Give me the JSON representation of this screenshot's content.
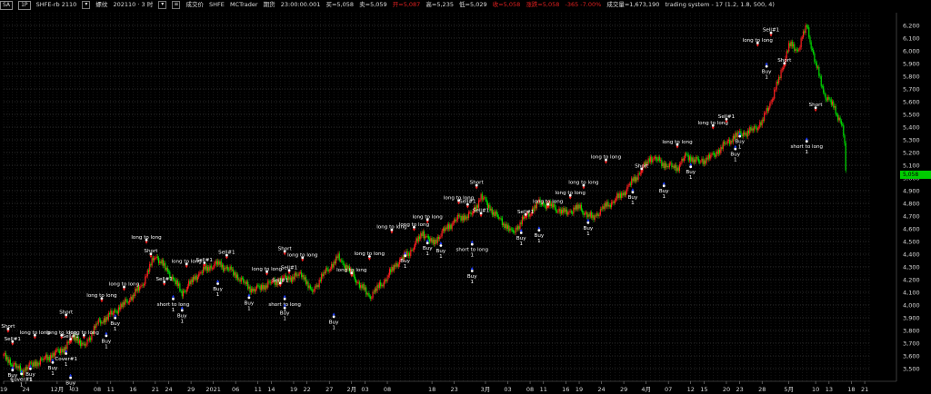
{
  "header": {
    "tab_symbol": "SA",
    "tab_interval": "1P",
    "symbol_name": "SHFE-rb 2110",
    "contract": "螺纹",
    "bar_period": "202110 · 3 时",
    "status_items": [
      "成交价",
      "SHFE",
      "MCTrader",
      "期货"
    ],
    "time": "23:00:00.001",
    "buy_label": "买=5,058",
    "sell_label": "卖=5,059",
    "open_label": "开=5,087",
    "high_label": "高=5,235",
    "low_label": "低=5,029",
    "close_label": "收=5,058",
    "change_label": "涨跌=5,058",
    "change_pct_label": "-365  -7.00%",
    "volume_label": "成交量=1,673,190",
    "system_label": "trading system - 17 (1.2,  1.8,  500,  4)"
  },
  "last_price_label": "5,058",
  "colors": {
    "up": "#ff2020",
    "down": "#00dd00",
    "grid": "#555555",
    "buy": "#2040ff",
    "sell": "#ff2020",
    "bg": "#000000",
    "last": "#00cc00"
  },
  "chart_data": {
    "type": "candlestick",
    "y_range": [
      3400,
      6300
    ],
    "y_ticks": [
      3500,
      3600,
      3700,
      3800,
      3900,
      4000,
      4100,
      4200,
      4300,
      4400,
      4500,
      4600,
      4700,
      4800,
      4900,
      5000,
      5100,
      5200,
      5300,
      5400,
      5500,
      5600,
      5700,
      5800,
      5900,
      6000,
      6100,
      6200
    ],
    "y_tick_labels": [
      "3,500",
      "3,600",
      "3,700",
      "3,800",
      "3,900",
      "4,000",
      "4,100",
      "4,200",
      "4,300",
      "4,400",
      "4,500",
      "4,600",
      "4,700",
      "4,800",
      "4,900",
      "5,000",
      "5,100",
      "5,200",
      "5,300",
      "5,400",
      "5,500",
      "5,600",
      "5,700",
      "5,800",
      "5,900",
      "6,000",
      "6,100",
      "6,200"
    ],
    "x_ticks": [
      "19",
      "24",
      "12月",
      "03",
      "08",
      "11",
      "16",
      "21",
      "24",
      "29",
      "2021",
      "06",
      "11",
      "14",
      "19",
      "22",
      "27",
      "2月",
      "03",
      "08",
      "18",
      "23",
      "3月",
      "03",
      "08",
      "11",
      "16",
      "19",
      "24",
      "29",
      "4月",
      "07",
      "12",
      "15",
      "20",
      "23",
      "28",
      "5月",
      "10",
      "13",
      "18",
      "21"
    ],
    "x_tick_days": [
      0,
      5,
      12,
      16,
      21,
      24,
      29,
      34,
      37,
      42,
      47,
      52,
      57,
      60,
      65,
      68,
      73,
      78,
      81,
      86,
      96,
      101,
      108,
      113,
      118,
      121,
      126,
      129,
      134,
      139,
      144,
      149,
      154,
      157,
      162,
      165,
      170,
      176,
      182,
      185,
      190,
      193
    ],
    "last_day": 189,
    "last_close": 5058,
    "anchors": [
      [
        0,
        3600
      ],
      [
        4,
        3480
      ],
      [
        8,
        3560
      ],
      [
        13,
        3640
      ],
      [
        16,
        3760
      ],
      [
        18,
        3660
      ],
      [
        21,
        3860
      ],
      [
        24,
        3920
      ],
      [
        27,
        4010
      ],
      [
        31,
        4150
      ],
      [
        34,
        4400
      ],
      [
        36,
        4300
      ],
      [
        38,
        4200
      ],
      [
        40,
        4100
      ],
      [
        43,
        4220
      ],
      [
        46,
        4300
      ],
      [
        48,
        4330
      ],
      [
        52,
        4240
      ],
      [
        56,
        4110
      ],
      [
        60,
        4180
      ],
      [
        64,
        4210
      ],
      [
        67,
        4250
      ],
      [
        69,
        4090
      ],
      [
        72,
        4260
      ],
      [
        75,
        4370
      ],
      [
        78,
        4250
      ],
      [
        82,
        4060
      ],
      [
        85,
        4180
      ],
      [
        88,
        4320
      ],
      [
        91,
        4420
      ],
      [
        94,
        4570
      ],
      [
        96,
        4480
      ],
      [
        99,
        4600
      ],
      [
        102,
        4680
      ],
      [
        105,
        4720
      ],
      [
        107,
        4850
      ],
      [
        110,
        4720
      ],
      [
        112,
        4650
      ],
      [
        114,
        4560
      ],
      [
        117,
        4700
      ],
      [
        120,
        4800
      ],
      [
        123,
        4780
      ],
      [
        126,
        4720
      ],
      [
        129,
        4770
      ],
      [
        132,
        4680
      ],
      [
        135,
        4780
      ],
      [
        139,
        4880
      ],
      [
        142,
        5020
      ],
      [
        145,
        5160
      ],
      [
        148,
        5110
      ],
      [
        151,
        5080
      ],
      [
        153,
        5170
      ],
      [
        156,
        5130
      ],
      [
        159,
        5170
      ],
      [
        162,
        5280
      ],
      [
        164,
        5330
      ],
      [
        167,
        5360
      ],
      [
        170,
        5440
      ],
      [
        172,
        5600
      ],
      [
        174,
        5800
      ],
      [
        176,
        6050
      ],
      [
        178,
        6000
      ],
      [
        180,
        6200
      ],
      [
        182,
        5900
      ],
      [
        184,
        5650
      ],
      [
        186,
        5560
      ],
      [
        188,
        5420
      ],
      [
        189,
        5058
      ]
    ],
    "signals": [
      {
        "day": 1,
        "price": 3780,
        "text": "Short",
        "kind": "sell"
      },
      {
        "day": 2,
        "price": 3680,
        "text": "Sell#1",
        "kind": "sell"
      },
      {
        "day": 2,
        "price": 3520,
        "text": "Buy",
        "kind": "buy"
      },
      {
        "day": 4,
        "price": 3490,
        "text": "Cover#1",
        "kind": "buy"
      },
      {
        "day": 6,
        "price": 3530,
        "text": "Buy",
        "kind": "buy"
      },
      {
        "day": 7,
        "price": 3730,
        "text": "long to long",
        "kind": "sell"
      },
      {
        "day": 13,
        "price": 3730,
        "text": "long to long",
        "kind": "sell"
      },
      {
        "day": 11,
        "price": 3580,
        "text": "Buy",
        "kind": "buy"
      },
      {
        "day": 14,
        "price": 3890,
        "text": "Short",
        "kind": "sell"
      },
      {
        "day": 15,
        "price": 3700,
        "text": "Sell#1",
        "kind": "sell"
      },
      {
        "day": 14,
        "price": 3650,
        "text": "Cover#1",
        "kind": "buy"
      },
      {
        "day": 15,
        "price": 3460,
        "text": "Buy",
        "kind": "buy"
      },
      {
        "day": 18,
        "price": 3730,
        "text": "long to long",
        "kind": "sell"
      },
      {
        "day": 22,
        "price": 4020,
        "text": "long to long",
        "kind": "sell"
      },
      {
        "day": 23,
        "price": 3790,
        "text": "Buy",
        "kind": "buy"
      },
      {
        "day": 27,
        "price": 4110,
        "text": "long to long",
        "kind": "sell"
      },
      {
        "day": 25,
        "price": 3930,
        "text": "Buy",
        "kind": "buy"
      },
      {
        "day": 32,
        "price": 4480,
        "text": "long to long",
        "kind": "sell"
      },
      {
        "day": 33,
        "price": 4370,
        "text": "Short",
        "kind": "sell"
      },
      {
        "day": 36,
        "price": 4150,
        "text": "Sell#1",
        "kind": "sell"
      },
      {
        "day": 38,
        "price": 4080,
        "text": "short to long",
        "kind": "buy"
      },
      {
        "day": 40,
        "price": 3990,
        "text": "Buy",
        "kind": "buy"
      },
      {
        "day": 41,
        "price": 4290,
        "text": "long to long",
        "kind": "sell"
      },
      {
        "day": 45,
        "price": 4300,
        "text": "Sell#1",
        "kind": "sell"
      },
      {
        "day": 50,
        "price": 4360,
        "text": "Sell#1",
        "kind": "sell"
      },
      {
        "day": 48,
        "price": 4200,
        "text": "Buy",
        "kind": "buy"
      },
      {
        "day": 55,
        "price": 4090,
        "text": "Buy",
        "kind": "buy"
      },
      {
        "day": 59,
        "price": 4230,
        "text": "long to long",
        "kind": "sell"
      },
      {
        "day": 63,
        "price": 4390,
        "text": "Short",
        "kind": "sell"
      },
      {
        "day": 62,
        "price": 4140,
        "text": "Sell#1",
        "kind": "sell"
      },
      {
        "day": 63,
        "price": 4080,
        "text": "short to long",
        "kind": "buy"
      },
      {
        "day": 63,
        "price": 4010,
        "text": "Buy",
        "kind": "buy"
      },
      {
        "day": 67,
        "price": 4340,
        "text": "long to long",
        "kind": "sell"
      },
      {
        "day": 64,
        "price": 4240,
        "text": "Sell#1",
        "kind": "sell"
      },
      {
        "day": 74,
        "price": 3940,
        "text": "Buy",
        "kind": "buy"
      },
      {
        "day": 78,
        "price": 4220,
        "text": "long to long",
        "kind": "sell"
      },
      {
        "day": 82,
        "price": 4350,
        "text": "long to long",
        "kind": "sell"
      },
      {
        "day": 87,
        "price": 4560,
        "text": "long to long",
        "kind": "sell"
      },
      {
        "day": 90,
        "price": 4420,
        "text": "Buy",
        "kind": "buy"
      },
      {
        "day": 92,
        "price": 4580,
        "text": "long to long",
        "kind": "sell"
      },
      {
        "day": 95,
        "price": 4640,
        "text": "long to long",
        "kind": "sell"
      },
      {
        "day": 95,
        "price": 4520,
        "text": "Buy",
        "kind": "buy"
      },
      {
        "day": 98,
        "price": 4500,
        "text": "Buy",
        "kind": "buy"
      },
      {
        "day": 102,
        "price": 4790,
        "text": "long to long",
        "kind": "sell"
      },
      {
        "day": 104,
        "price": 4760,
        "text": "Sell#1",
        "kind": "sell"
      },
      {
        "day": 106,
        "price": 4910,
        "text": "Short",
        "kind": "sell"
      },
      {
        "day": 107,
        "price": 4690,
        "text": "Sell#1",
        "kind": "sell"
      },
      {
        "day": 105,
        "price": 4510,
        "text": "short to long",
        "kind": "buy"
      },
      {
        "day": 105,
        "price": 4300,
        "text": "Buy",
        "kind": "buy"
      },
      {
        "day": 117,
        "price": 4680,
        "text": "Sell#1",
        "kind": "sell"
      },
      {
        "day": 116,
        "price": 4600,
        "text": "Buy",
        "kind": "buy"
      },
      {
        "day": 122,
        "price": 4760,
        "text": "long to long",
        "kind": "sell"
      },
      {
        "day": 120,
        "price": 4620,
        "text": "Buy",
        "kind": "buy"
      },
      {
        "day": 127,
        "price": 4830,
        "text": "long to long",
        "kind": "sell"
      },
      {
        "day": 130,
        "price": 4910,
        "text": "long to long",
        "kind": "sell"
      },
      {
        "day": 131,
        "price": 4680,
        "text": "Buy",
        "kind": "buy"
      },
      {
        "day": 135,
        "price": 5110,
        "text": "long to long",
        "kind": "sell"
      },
      {
        "day": 143,
        "price": 5040,
        "text": "Short",
        "kind": "sell"
      },
      {
        "day": 141,
        "price": 4920,
        "text": "Buy",
        "kind": "buy"
      },
      {
        "day": 148,
        "price": 4970,
        "text": "Buy",
        "kind": "buy"
      },
      {
        "day": 151,
        "price": 5230,
        "text": "long to long",
        "kind": "sell"
      },
      {
        "day": 154,
        "price": 5120,
        "text": "Buy",
        "kind": "buy"
      },
      {
        "day": 159,
        "price": 5380,
        "text": "long to long",
        "kind": "sell"
      },
      {
        "day": 162,
        "price": 5430,
        "text": "Sell#1",
        "kind": "sell"
      },
      {
        "day": 164,
        "price": 5260,
        "text": "Buy",
        "kind": "buy"
      },
      {
        "day": 165,
        "price": 5360,
        "text": "Buy",
        "kind": "buy"
      },
      {
        "day": 169,
        "price": 6030,
        "text": "long to long",
        "kind": "sell"
      },
      {
        "day": 172,
        "price": 6110,
        "text": "Sell#1",
        "kind": "sell"
      },
      {
        "day": 171,
        "price": 5910,
        "text": "Buy",
        "kind": "buy"
      },
      {
        "day": 175,
        "price": 5870,
        "text": "Short",
        "kind": "sell"
      },
      {
        "day": 182,
        "price": 5520,
        "text": "Short",
        "kind": "sell"
      },
      {
        "day": 180,
        "price": 5320,
        "text": "short to long",
        "kind": "buy"
      }
    ]
  }
}
